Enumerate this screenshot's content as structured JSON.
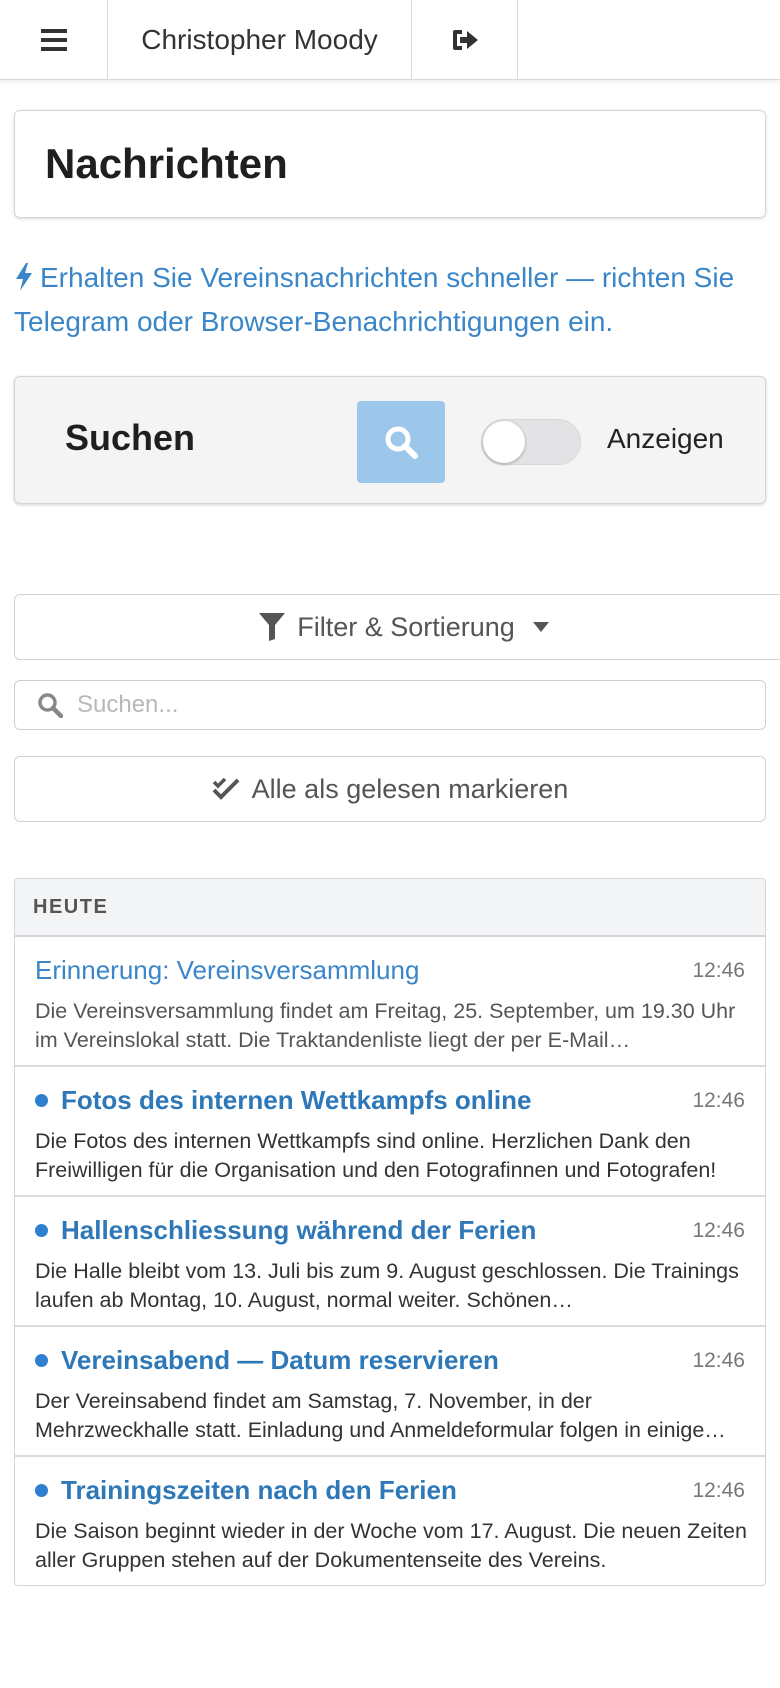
{
  "topbar": {
    "menu_icon": "hamburger-icon",
    "user_name": "Christopher Moody",
    "logout_icon": "sign-out-icon"
  },
  "page": {
    "title": "Nachrichten"
  },
  "promo": {
    "icon": "bolt-icon",
    "text": "Erhalten Sie Vereinsnachrichten schneller — richten Sie Telegram oder Browser-Benachrichtigungen ein."
  },
  "search_panel": {
    "label": "Suchen",
    "toggle_label": "Anzeigen",
    "toggle_on": false
  },
  "filter": {
    "label": "Filter & Sortierung"
  },
  "search": {
    "placeholder": "Suchen...",
    "value": ""
  },
  "mark_all": {
    "label": "Alle als gelesen markieren"
  },
  "list": {
    "header": "HEUTE",
    "messages": [
      {
        "title": "Erinnerung: Vereinsversammlung",
        "time": "12:46",
        "body": "Die Vereinsversammlung findet am Freitag, 25. September, um 19.30 Uhr im Vereinslokal statt. Die Traktandenliste liegt der per E-Mail…",
        "unread": false
      },
      {
        "title": "Fotos des internen Wettkampfs online",
        "time": "12:46",
        "body": "Die Fotos des internen Wettkampfs sind online. Herzlichen Dank den Freiwilligen für die Organisation und den Fotografinnen und Fotografen!",
        "unread": true
      },
      {
        "title": "Hallenschliessung während der Ferien",
        "time": "12:46",
        "body": "Die Halle bleibt vom 13. Juli bis zum 9. August geschlossen. Die Trainings laufen ab Montag, 10. August, normal weiter. Schönen…",
        "unread": true
      },
      {
        "title": "Vereinsabend — Datum reservieren",
        "time": "12:46",
        "body": "Der Vereinsabend findet am Samstag, 7. November, in der Mehrzweckhalle statt. Einladung und Anmeldeformular folgen in einige…",
        "unread": true
      },
      {
        "title": "Trainingszeiten nach den Ferien",
        "time": "12:46",
        "body": "Die Saison beginnt wieder in der Woche vom 17. August. Die neuen Zeiten aller Gruppen stehen auf der Dokumentenseite des Vereins.",
        "unread": true
      }
    ]
  }
}
